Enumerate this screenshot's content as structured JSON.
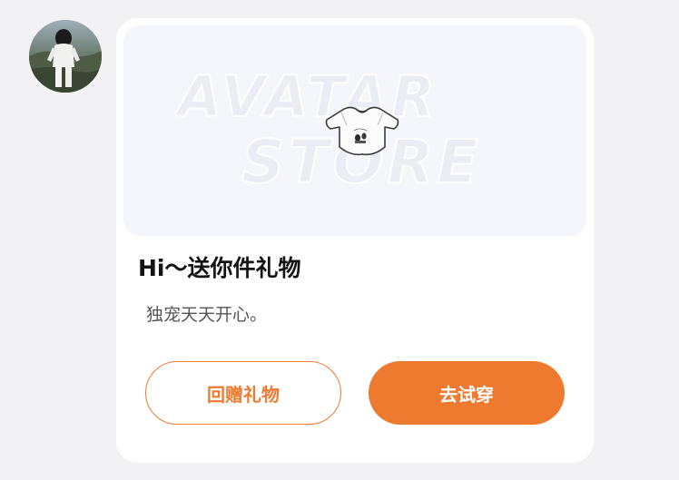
{
  "avatar": {
    "icon": "user-avatar-photo"
  },
  "gift_card": {
    "banner_watermark_top": "AVATAR",
    "banner_watermark_bottom": "STORE",
    "gift_item_icon": "crop-top-shirt-icon",
    "title": "Hi～送你件礼物",
    "message": "独宠天天开心。",
    "return_gift_label": "回赠礼物",
    "try_on_label": "去试穿"
  },
  "colors": {
    "accent": "#ee7a30",
    "page_background": "#f2f2f4",
    "card_background": "#ffffff",
    "banner_background": "#f5f6fb"
  }
}
